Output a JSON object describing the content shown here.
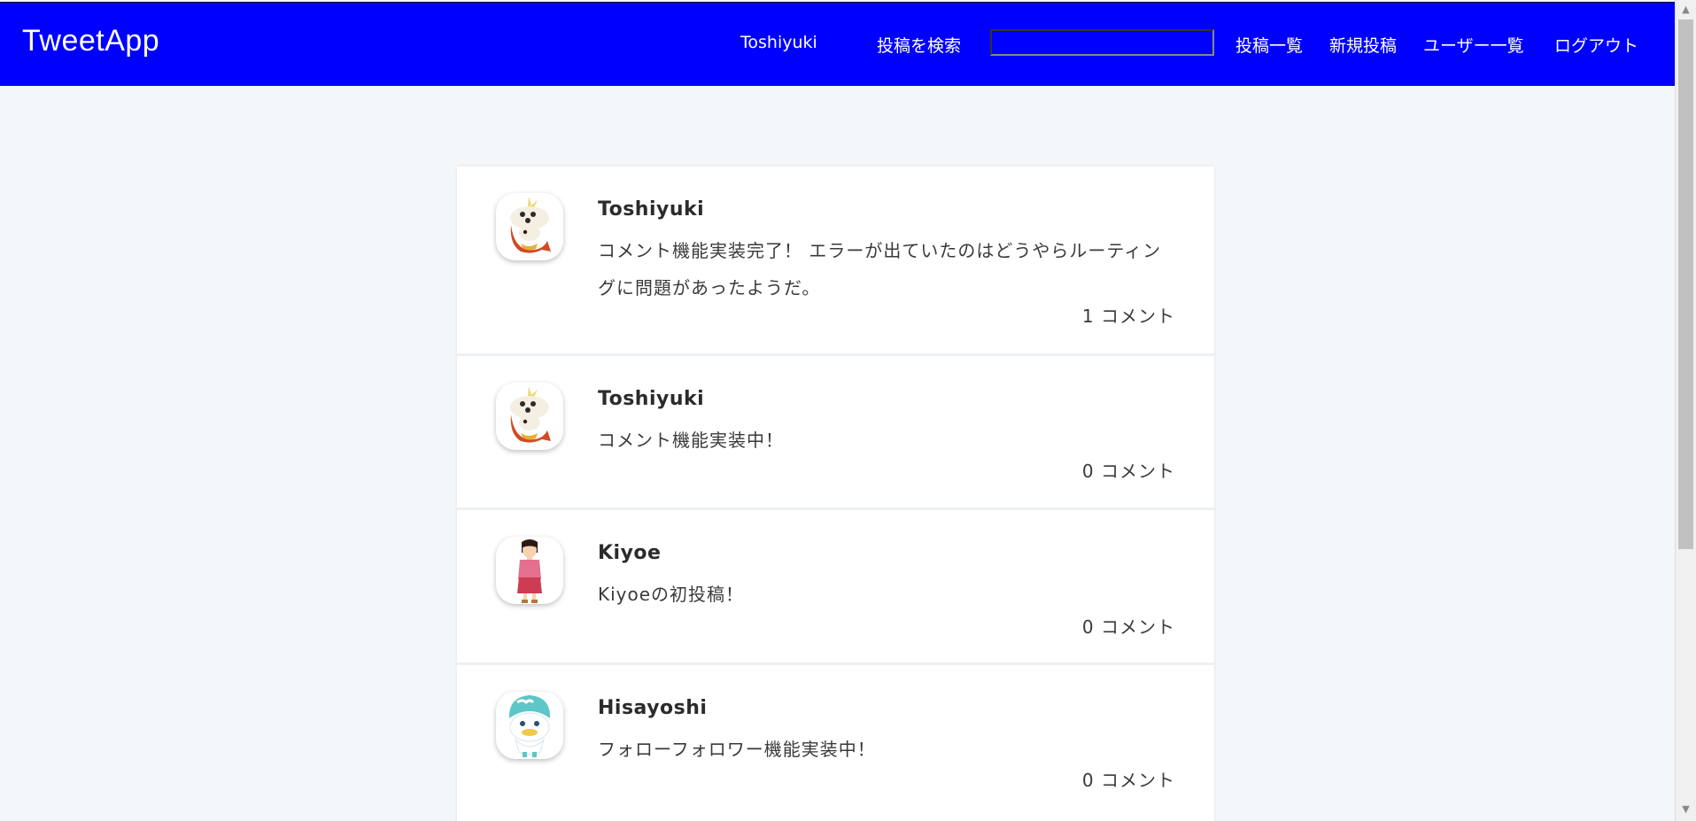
{
  "header": {
    "brand": "TweetApp",
    "current_user": "Toshiyuki",
    "search_label": "投稿を検索",
    "search_value": "",
    "nav": [
      "投稿一覧",
      "新規投稿",
      "ユーザー一覧",
      "ログアウト"
    ]
  },
  "posts": [
    {
      "user": "Toshiyuki",
      "avatar_icon": "fuecoco-avatar-icon",
      "body": "コメント機能実装完了！ エラーが出ていたのはどうやらルーティングに問題があったようだ。",
      "comments": "1 コメント"
    },
    {
      "user": "Toshiyuki",
      "avatar_icon": "fuecoco-avatar-icon",
      "body": "コメント機能実装中！",
      "comments": "0 コメント"
    },
    {
      "user": "Kiyoe",
      "avatar_icon": "woman-avatar-icon",
      "body": "Kiyoeの初投稿！",
      "comments": "0 コメント"
    },
    {
      "user": "Hisayoshi",
      "avatar_icon": "quaxly-avatar-icon",
      "body": "フォローフォロワー機能実装中！",
      "comments": "0 コメント"
    }
  ],
  "colors": {
    "header_bg": "#0000ff",
    "page_bg": "#f4f7fa",
    "card_bg": "#ffffff"
  }
}
